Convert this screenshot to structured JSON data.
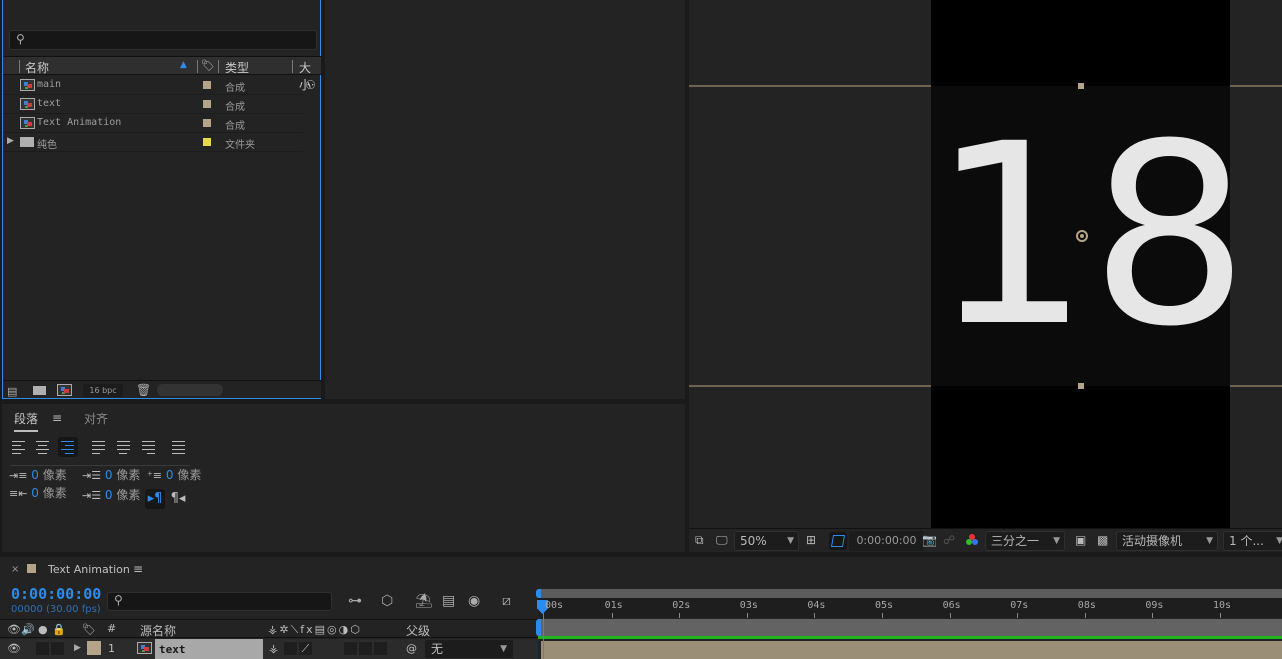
{
  "project": {
    "search_placeholder": "",
    "columns": {
      "name": "名称",
      "type": "类型",
      "size": "大小"
    },
    "items": [
      {
        "name": "main",
        "kind": "composition",
        "type": "合成",
        "label_color": "#b5a48a"
      },
      {
        "name": "text",
        "kind": "composition",
        "type": "合成",
        "label_color": "#b5a48a"
      },
      {
        "name": "Text Animation",
        "kind": "composition",
        "type": "合成",
        "label_color": "#b5a48a"
      },
      {
        "name": "纯色",
        "kind": "folder",
        "type": "文件夹",
        "label_color": "#e8d94a"
      }
    ],
    "footer": {
      "bpc": "16 bpc"
    }
  },
  "paragraph": {
    "tabs": [
      {
        "label": "段落",
        "active": true
      },
      {
        "label": "对齐",
        "active": false
      }
    ],
    "menu_icon": "≡",
    "align_active_index": 2,
    "indents": {
      "left": {
        "value": "0",
        "unit": "像素"
      },
      "first_line": {
        "value": "0",
        "unit": "像素"
      },
      "space_before": {
        "value": "0",
        "unit": "像素"
      },
      "right": {
        "value": "0",
        "unit": "像素"
      },
      "space_after": {
        "value": "0",
        "unit": "像素"
      }
    }
  },
  "viewer": {
    "content_text": "18",
    "toolbar": {
      "zoom": "50%",
      "timecode": "0:00:00:00",
      "resolution": "三分之一",
      "camera": "活动摄像机",
      "views": "1 个..."
    }
  },
  "timeline": {
    "comp_name": "Text Animation",
    "comp_color": "#b5a48a",
    "current_time": "0:00:00:00",
    "frames_fps": "00000 (30.00 fps)",
    "columns": {
      "num": "#",
      "source_name": "源名称",
      "parent": "父级"
    },
    "ruler_labels": [
      "00s",
      "01s",
      "02s",
      "03s",
      "04s",
      "05s",
      "06s",
      "07s",
      "08s",
      "09s",
      "10s"
    ],
    "layers": [
      {
        "index": "1",
        "name": "text",
        "label_color": "#b5a48a",
        "parent": "无"
      }
    ]
  },
  "colors": {
    "accent": "#2d8ceb",
    "panel": "#232323",
    "track_green": "#1fb51f"
  }
}
